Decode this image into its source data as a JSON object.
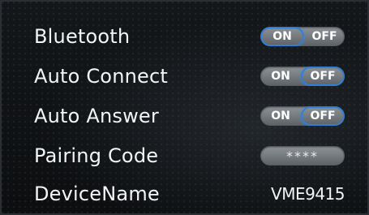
{
  "settings": {
    "bluetooth": {
      "label": "Bluetooth",
      "on": "ON",
      "off": "OFF",
      "selected": "ON"
    },
    "auto_connect": {
      "label": "Auto Connect",
      "on": "ON",
      "off": "OFF",
      "selected": "OFF"
    },
    "auto_answer": {
      "label": "Auto Answer",
      "on": "ON",
      "off": "OFF",
      "selected": "OFF"
    },
    "pairing_code": {
      "label": "Pairing Code",
      "value": "****"
    },
    "device_name": {
      "label": "DeviceName",
      "value": "VME9415"
    }
  },
  "colors": {
    "highlight": "#2f7fd8",
    "toggle_track": "#7a7f84",
    "text": "#f2f4f6"
  }
}
